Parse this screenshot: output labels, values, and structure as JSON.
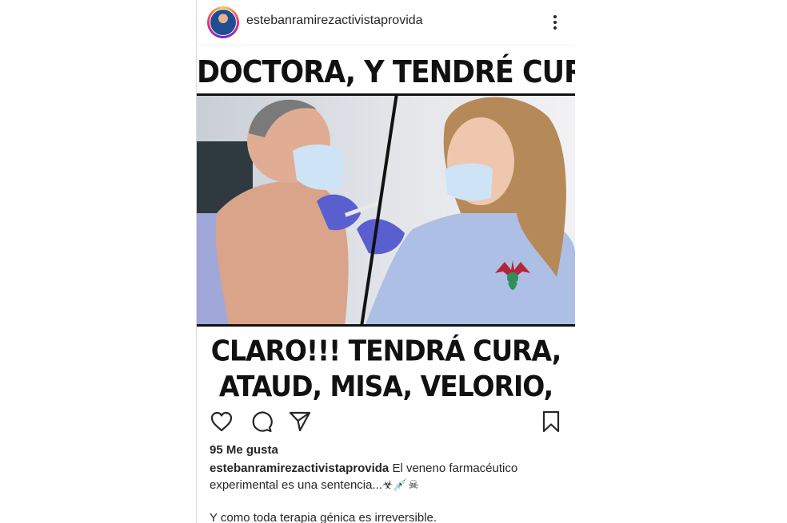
{
  "post": {
    "username": "estebanramirezactivistaprovida",
    "image": {
      "top_text": "DOCTORA, Y TENDRÉ CURA?",
      "bottom_line1": "CLARO!!! TENDRÁ CURA,",
      "bottom_line2": "ATAUD, MISA, VELORIO, ETC!!!"
    },
    "likes": "95 Me gusta",
    "caption_user": "estebanramirezactivistaprovida",
    "caption_text": "El veneno farmacéutico experimental es una sentencia...☣💉☠",
    "caption_text2": "Y como toda terapia génica es irreversible."
  },
  "icons": [
    "avatar",
    "more-icon",
    "heart-icon",
    "comment-icon",
    "share-icon",
    "bookmark-icon"
  ]
}
